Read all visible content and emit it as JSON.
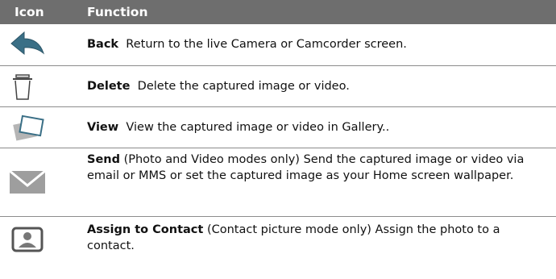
{
  "header": {
    "col1": "Icon",
    "col2": "Function"
  },
  "rows": [
    {
      "icon": "back-arrow-icon",
      "name": "Back",
      "desc": "Return to the live Camera or Camcorder screen."
    },
    {
      "icon": "trash-icon",
      "name": "Delete",
      "desc": "Delete the captured image or video."
    },
    {
      "icon": "photos-icon",
      "name": "View",
      "desc": "View the captured image or video in Gallery.."
    },
    {
      "icon": "envelope-icon",
      "name": "Send",
      "desc": "(Photo and Video modes only)  Send the captured image or video via email or MMS or set the captured image as your Home screen wallpaper."
    },
    {
      "icon": "contact-icon",
      "name": "Assign to Contact",
      "desc": "(Contact picture mode only)  Assign the photo to a contact."
    }
  ]
}
